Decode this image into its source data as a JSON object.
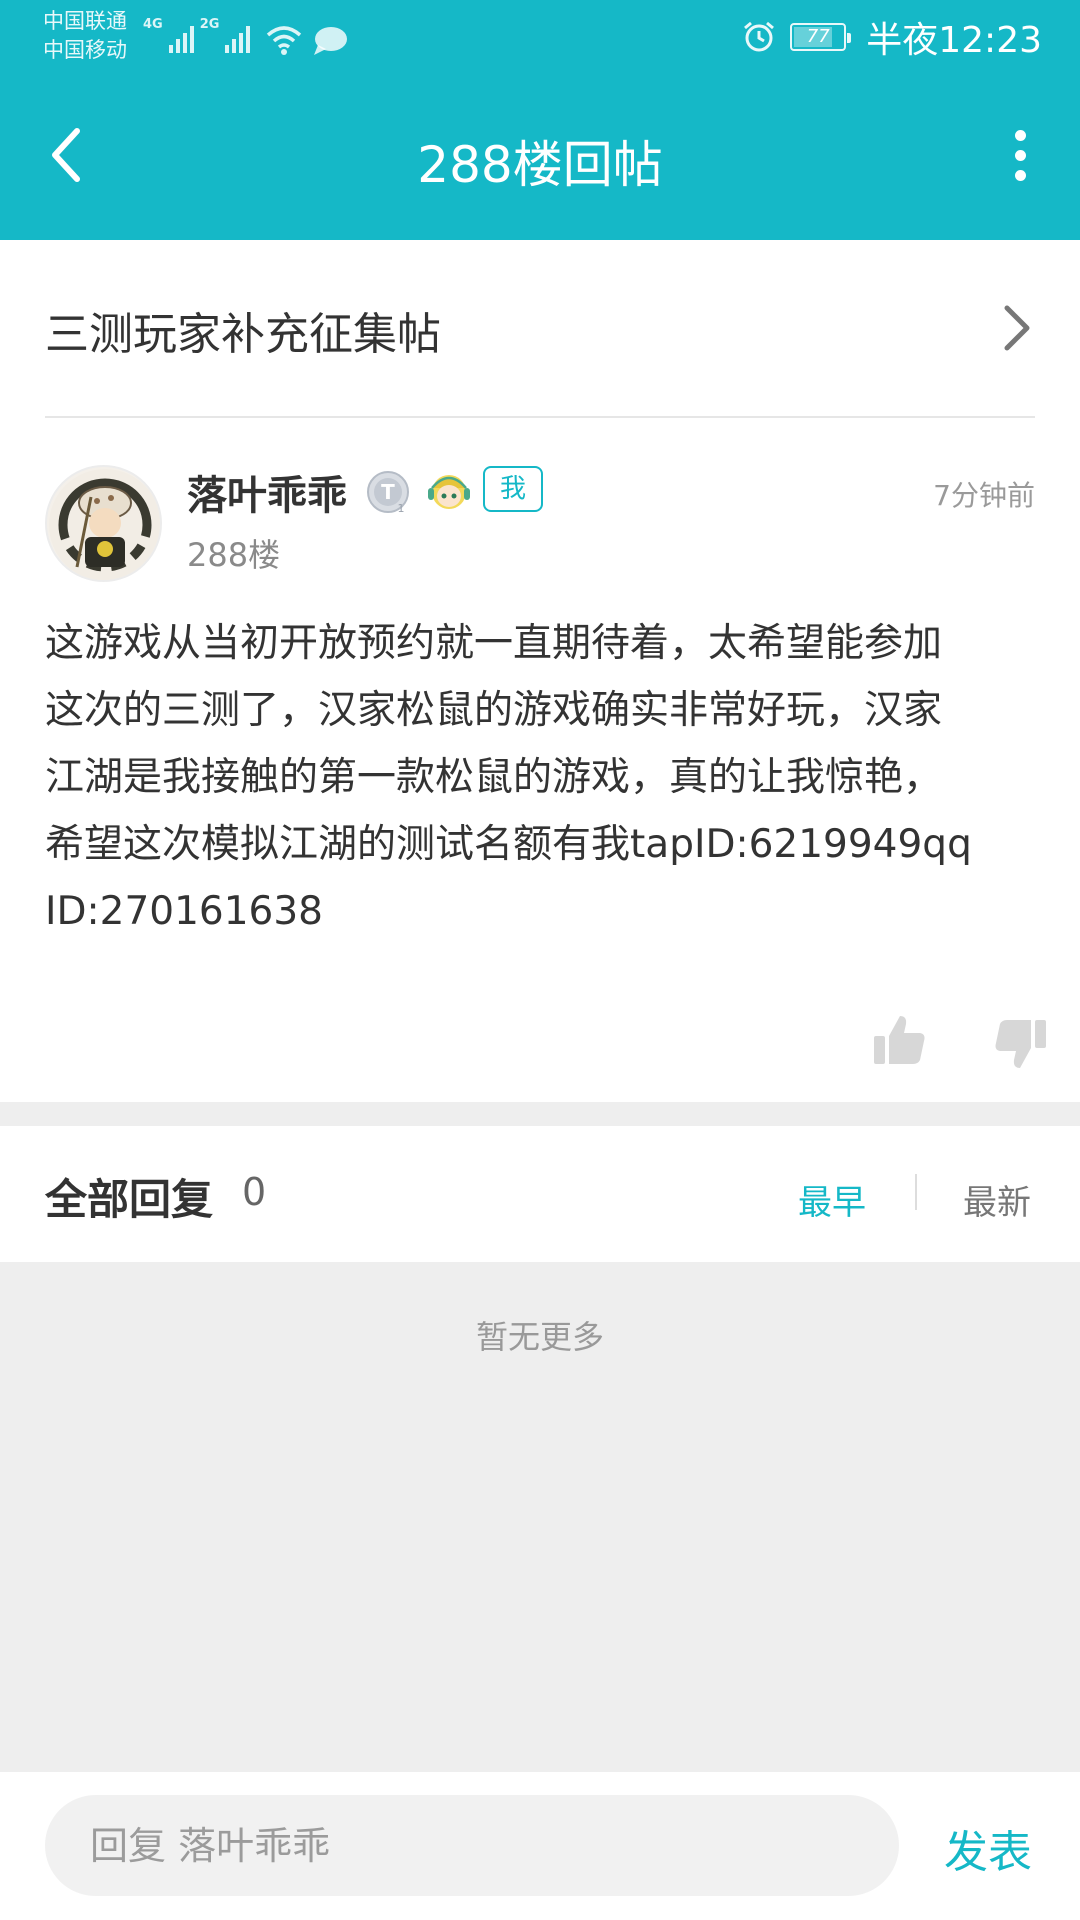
{
  "colors": {
    "accent": "#15b8c7",
    "header_bg": "#15b8c7",
    "band_bg": "#eeeeee"
  },
  "status_bar": {
    "carrier_1": "中国联通",
    "carrier_2": "中国移动",
    "network_1": "4G",
    "network_2": "2G",
    "battery": "77",
    "time": "半夜12:23",
    "icons": [
      "signal-icon",
      "wifi-icon",
      "chat-bubble-icon",
      "alarm-icon",
      "battery-icon"
    ]
  },
  "app_bar": {
    "title": "288楼回帖",
    "back_icon": "chevron-left-icon",
    "more_icon": "more-vertical-icon"
  },
  "topic": {
    "title": "三测玩家补充征集帖",
    "arrow_icon": "chevron-right-icon"
  },
  "post": {
    "username": "落叶乖乖",
    "me_tag": "我",
    "time": "7分钟前",
    "floor": "288楼",
    "body": "这游戏从当初开放预约就一直期待着，太希望能参加\n这次的三测了，汉家松鼠的游戏确实非常好玩，汉家\n江湖是我接触的第一款松鼠的游戏，真的让我惊艳，\n希望这次模拟江湖的测试名额有我tapID:6219949qq\nID:270161638",
    "like_icon": "thumbs-up-icon",
    "dislike_icon": "thumbs-down-icon"
  },
  "replies": {
    "label": "全部回复",
    "count": "0",
    "sort_earliest": "最早",
    "sort_latest": "最新",
    "empty_text": "暂无更多"
  },
  "reply_bar": {
    "placeholder": "回复 落叶乖乖",
    "send_label": "发表"
  }
}
